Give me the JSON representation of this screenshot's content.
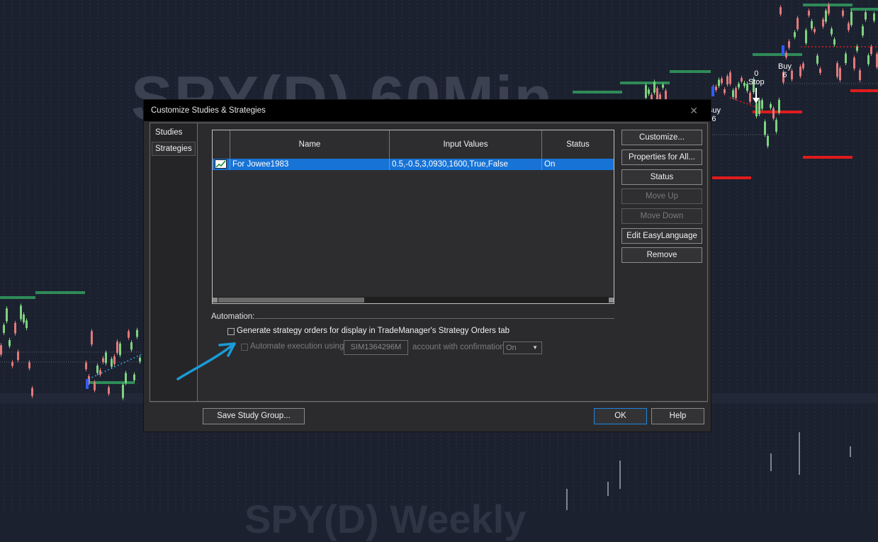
{
  "chart": {
    "watermark_top": "SPY(D) 60Min",
    "watermark_bottom": "SPY(D) Weekly",
    "labels": [
      {
        "id": "buy-left",
        "text": "Buy\n6"
      },
      {
        "id": "stop",
        "text": "0\nStop"
      },
      {
        "id": "buy-right",
        "text": "Buy\n6"
      }
    ]
  },
  "dialog": {
    "title": "Customize Studies & Strategies",
    "close_glyph": "✕",
    "nav": [
      {
        "label": "Studies",
        "selected": false
      },
      {
        "label": "Strategies",
        "selected": true
      }
    ],
    "grid": {
      "headers": [
        "",
        "Name",
        "Input Values",
        "Status"
      ],
      "rows": [
        {
          "name": "For Jowee1983",
          "inputs": "0.5,-0.5,3,0930,1600,True,False",
          "status": "On",
          "selected": true
        }
      ]
    },
    "buttons": {
      "customize": "Customize...",
      "properties_all": "Properties for All...",
      "status": "Status",
      "move_up": "Move Up",
      "move_down": "Move Down",
      "edit_el": "Edit EasyLanguage",
      "remove": "Remove"
    },
    "automation": {
      "label": "Automation:",
      "generate_orders": {
        "label": "Generate strategy orders for display in TradeManager's Strategy Orders tab",
        "checked": false
      },
      "automate": {
        "label": "Automate execution using",
        "checked": false,
        "enabled": false
      },
      "account": "SIM1364296M",
      "account_suffix": "account with confirmation",
      "confirmation": "On"
    },
    "footer": {
      "save_group": "Save Study Group...",
      "ok": "OK",
      "help": "Help"
    }
  },
  "colors": {
    "chart_bg": "#1c2130",
    "selection": "#1873d6",
    "level_green": "#2e8b57",
    "level_red": "#e01b1b",
    "annotation_arrow": "#1a9bd7"
  }
}
